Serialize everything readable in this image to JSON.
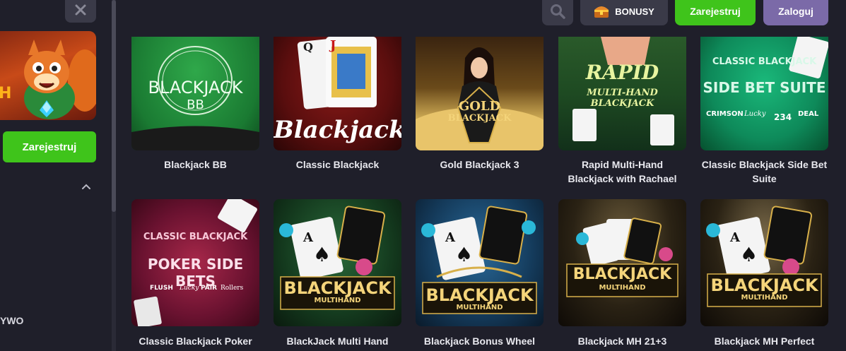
{
  "sidebar": {
    "close_icon": "close-icon",
    "promo_partial_text": "H",
    "register_label": "Zarejestruj",
    "collapse_icon": "chevron-up-icon",
    "partial_item_text": "YWO"
  },
  "header": {
    "search_icon": "search-icon",
    "bonus_icon": "treasure-chest-icon",
    "bonus_label": "BONUSY",
    "register_label": "Zarejestruj",
    "login_label": "Zaloguj"
  },
  "colors": {
    "background": "#1f1f2a",
    "register_green": "#3fc41b",
    "login_purple": "#7b6aa8",
    "header_button": "#3a3a48"
  },
  "games": [
    {
      "title": "Blackjack BB",
      "art_text": "BLACKJACK",
      "art_sub": "BB"
    },
    {
      "title": "Classic Blackjack",
      "art_text": "Blackjack"
    },
    {
      "title": "Gold Blackjack 3",
      "art_text": "GOLD",
      "art_sub": "BLACKJACK"
    },
    {
      "title": "Rapid Multi-Hand Blackjack with Rachael",
      "art_text": "RAPID",
      "art_sub": "MULTI-HAND BLACKJACK"
    },
    {
      "title": "Classic Blackjack Side Bet Suite",
      "art_text": "CLASSIC BLACKJACK",
      "art_sub": "SIDE BET SUITE"
    },
    {
      "title": "Classic Blackjack Poker",
      "art_text": "CLASSIC BLACKJACK",
      "art_sub": "POKER SIDE BETS"
    },
    {
      "title": "BlackJack Multi Hand",
      "art_text": "BLACKJACK",
      "art_sub": "MULTIHAND"
    },
    {
      "title": "Blackjack Bonus Wheel",
      "art_text": "BLACKJACK",
      "art_sub": "MULTIHAND"
    },
    {
      "title": "Blackjack MH 21+3",
      "art_text": "BLACKJACK",
      "art_sub": "MULTIHAND"
    },
    {
      "title": "Blackjack MH Perfect",
      "art_text": "BLACKJACK",
      "art_sub": "MULTIHAND"
    }
  ]
}
